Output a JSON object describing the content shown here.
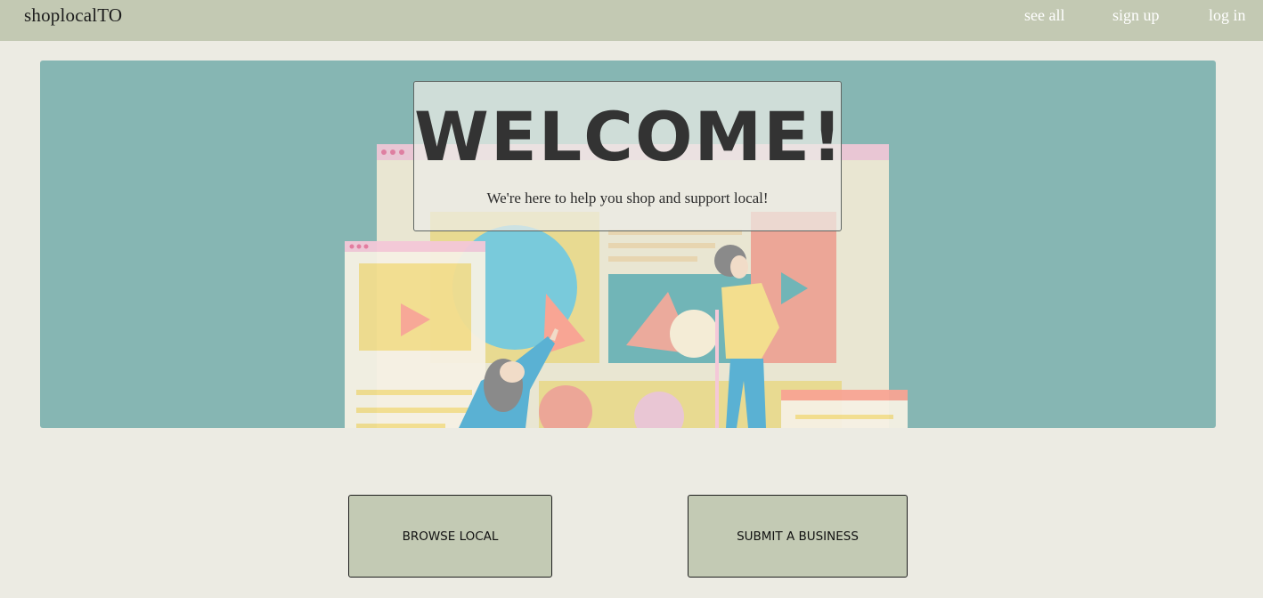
{
  "header": {
    "brand": "shoplocalTO",
    "nav": {
      "see_all": "see all",
      "sign_up": "sign up",
      "log_in": "log in"
    }
  },
  "hero": {
    "title": "WELCOME!",
    "subtitle": "We're here to help you shop and support local!",
    "illustration": "people-arranging-web-page-shapes-illustration"
  },
  "actions": {
    "browse_label": "BROWSE LOCAL",
    "submit_label": "SUBMIT A BUSINESS"
  },
  "colors": {
    "page_bg": "#ecebe3",
    "navbar_bg": "#c3c9b3",
    "hero_bg": "#86b6b3",
    "button_bg": "#c3cab4"
  }
}
